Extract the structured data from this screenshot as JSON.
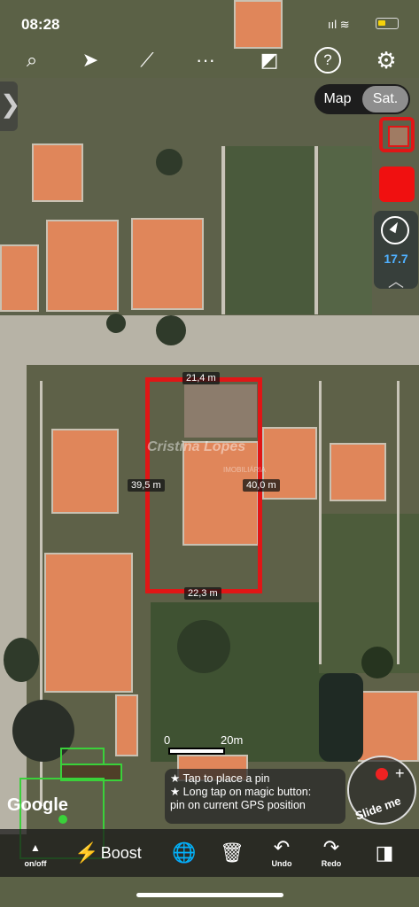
{
  "status": {
    "time": "08:28",
    "signal": "ııl ≋"
  },
  "toolbar": {
    "search": "⌕",
    "navigate": "➤",
    "measure": "⟋",
    "more": "···",
    "ruler": "◩",
    "help": "?",
    "settings": "⚙"
  },
  "map_type": {
    "map": "Map",
    "sat": "Sat."
  },
  "compass": {
    "speed": "17.7",
    "chevron": "︿"
  },
  "side_tab": "❯",
  "plot": {
    "top": "21,4 m",
    "left": "39,5 m",
    "right": "40,0 m",
    "bottom": "22,3 m"
  },
  "watermark": {
    "name": "Cristina Lopes",
    "sub": "IMOBILIÁRIA"
  },
  "scale": {
    "zero": "0",
    "max": "20m"
  },
  "tip": {
    "line1": "★ Tap to place a pin",
    "line2": "★ Long tap on magic button:",
    "line3": "pin on current GPS position"
  },
  "slide_me": {
    "label": "Slide me",
    "plus": "+"
  },
  "google": "Google",
  "bottom": {
    "onoff": "on/off",
    "onoff_icon": "▲",
    "boost": "Boost",
    "boost_icon": "⚡",
    "globe_icon": "🌐",
    "trash_icon": "🗑",
    "undo": "Undo",
    "undo_icon": "↶",
    "redo": "Redo",
    "redo_icon": "↷",
    "pin_icon": "◨"
  },
  "colors": {
    "accent_red": "#e01616",
    "speed_blue": "#4fb0ff",
    "gps_green": "#3ad13a"
  }
}
